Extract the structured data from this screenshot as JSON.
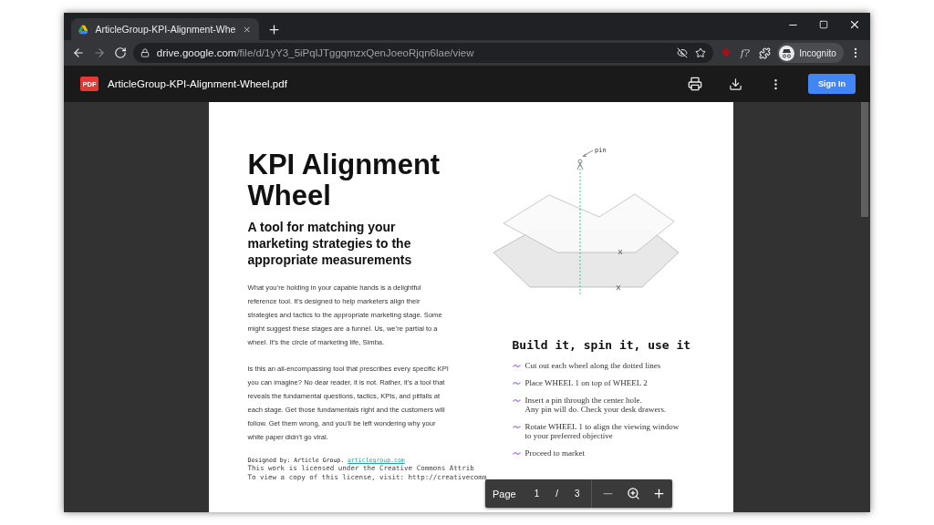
{
  "browser": {
    "tabs": [
      {
        "title": "ArticleGroup-KPI-Alignment-Whe",
        "selected": true
      }
    ],
    "nav_buttons": [
      {
        "kind": "back",
        "disabled": false
      },
      {
        "kind": "forward",
        "disabled": true
      },
      {
        "kind": "reload",
        "disabled": false
      }
    ],
    "url": {
      "host": "drive.google.com",
      "path": "/file/d/1yY3_5iPqlJTggqmzxQenJoeoRjqn6lae/view"
    },
    "extension_text": "f?",
    "profile": "Incognito"
  },
  "viewer": {
    "file_name": "ArticleGroup-KPI-Alignment-Wheel.pdf",
    "file_badge": "PDF",
    "sign_in": "Sign In"
  },
  "document": {
    "title": "KPI Alignment Wheel",
    "subtitle": "A tool for matching your marketing strategies to the appropriate measurements",
    "paragraphs": [
      "What you’re holding in your capable hands is a delightful reference tool. It’s designed to help marketers align their strategies and tactics to the appropriate marketing stage. Some might suggest these stages are a funnel. Us, we’re partial to a wheel. It’s the circle of marketing life, Simba.",
      "Is this an all-encompassing tool that prescribes every specific KPI you can imagine? No dear reader, it is not. Rather, it’s a tool that reveals the fundamental questions, tactics, KPIs, and pitfalls at each stage. Get those fundamentals right and the customers will follow. Get them wrong, and you’ll be left wondering why your white paper didn’t go viral."
    ],
    "diagram": {
      "pin_label": "pin"
    },
    "steps_heading": "Build it, spin it, use it",
    "steps": [
      {
        "lines": [
          "Cut out each wheel along the dotted lines"
        ]
      },
      {
        "lines": [
          "Place WHEEL 1 on top of WHEEL 2"
        ]
      },
      {
        "lines": [
          "Insert a pin through the center hole.",
          "Any pin will do. Check your desk drawers."
        ]
      },
      {
        "lines": [
          "Rotate WHEEL 1 to align the viewing window",
          "to your preferred objective"
        ]
      },
      {
        "lines": [
          "Proceed to market"
        ]
      }
    ],
    "credit": {
      "text": "Designed by: Article Group.",
      "link": "articlegroup.com"
    },
    "license_lines": [
      "This work is licensed under the Creative Commons Attrib",
      "To view a copy of this license, visit: http://creativecomm"
    ]
  },
  "page_nav": {
    "label": "Page",
    "current": "1",
    "separator": "/",
    "total": "3"
  }
}
